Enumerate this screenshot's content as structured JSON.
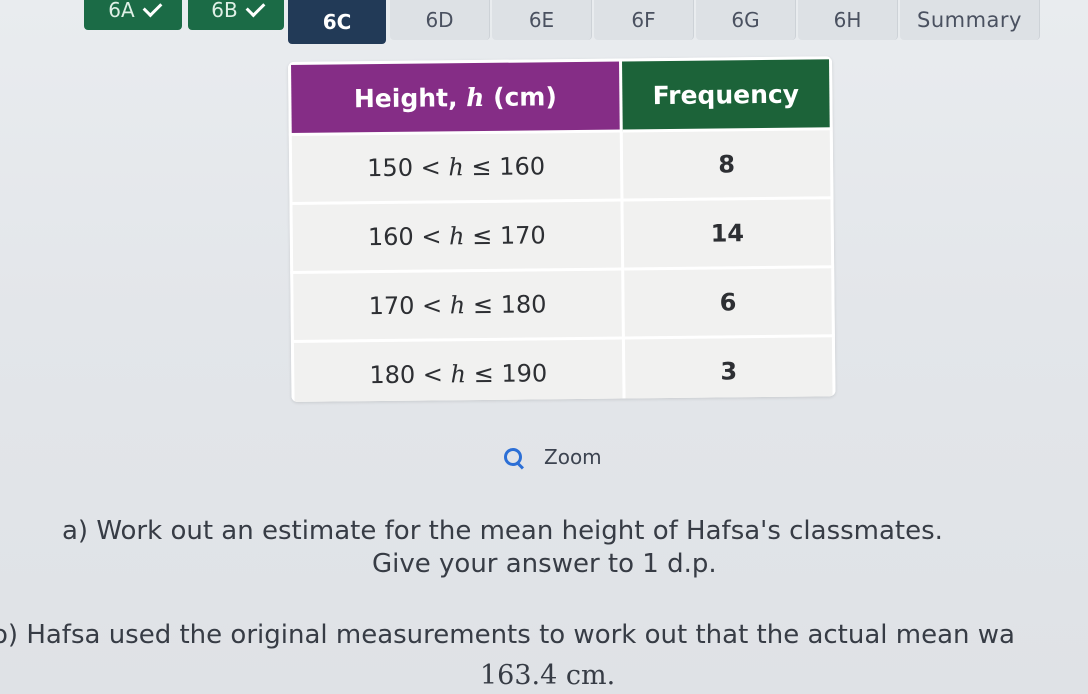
{
  "tabs": [
    {
      "label": "6A",
      "state": "done"
    },
    {
      "label": "6B",
      "state": "done"
    },
    {
      "label": "6C",
      "state": "active"
    },
    {
      "label": "6D",
      "state": "normal"
    },
    {
      "label": "6E",
      "state": "normal"
    },
    {
      "label": "6F",
      "state": "normal"
    },
    {
      "label": "6G",
      "state": "normal"
    },
    {
      "label": "6H",
      "state": "normal"
    },
    {
      "label": "Summary",
      "state": "normal"
    }
  ],
  "table": {
    "headers": {
      "height_prefix": "Height, ",
      "height_var": "h",
      "height_unit": " (cm)",
      "frequency": "Frequency"
    },
    "rows": [
      {
        "low": "150",
        "op1": " < ",
        "var": "h",
        "op2": " ≤ ",
        "high": "160",
        "frequency": "8"
      },
      {
        "low": "160",
        "op1": " < ",
        "var": "h",
        "op2": " ≤ ",
        "high": "170",
        "frequency": "14"
      },
      {
        "low": "170",
        "op1": " < ",
        "var": "h",
        "op2": " ≤ ",
        "high": "180",
        "frequency": "6"
      },
      {
        "low": "180",
        "op1": " < ",
        "var": "h",
        "op2": " ≤ ",
        "high": "190",
        "frequency": "3"
      }
    ]
  },
  "zoom": {
    "label": "Zoom",
    "icon": "magnifier-icon"
  },
  "questions": {
    "a_line1": "a) Work out an estimate for the mean height of Hafsa's classmates.",
    "a_line2": "Give your answer to 1 d.p.",
    "b_line1": "o) Hafsa used the original measurements to work out that the actual mean wa",
    "b_line2": "163.4 cm."
  },
  "colors": {
    "tab_done": "#1b6b46",
    "tab_active": "#223a57",
    "header_height": "#852d86",
    "header_frequency": "#1c6339",
    "zoom_icon": "#2c6fd6"
  }
}
